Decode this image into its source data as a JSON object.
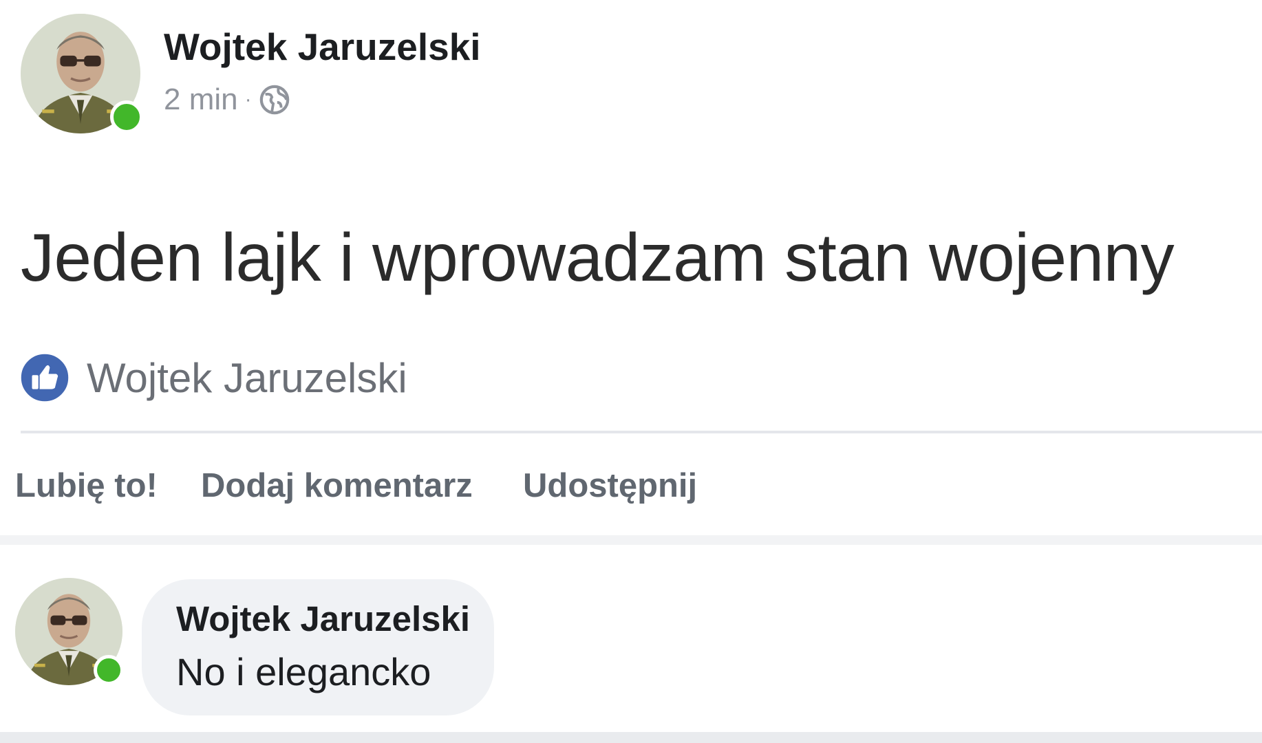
{
  "post": {
    "author": "Wojtek Jaruzelski",
    "timestamp": "2 min",
    "separator": "·",
    "privacy_icon": "globe-icon",
    "text": "Jeden lajk i wprowadzam stan wojenny"
  },
  "reactions": {
    "icon": "thumbs-up-icon",
    "liked_by": "Wojtek Jaruzelski"
  },
  "actions": {
    "like": "Lubię to!",
    "comment": "Dodaj komentarz",
    "share": "Udostępnij"
  },
  "comment": {
    "author": "Wojtek Jaruzelski",
    "text": "No i elegancko"
  },
  "colors": {
    "online": "#42b72a",
    "like_blue": "#4267b2",
    "bubble": "#f0f2f5"
  }
}
